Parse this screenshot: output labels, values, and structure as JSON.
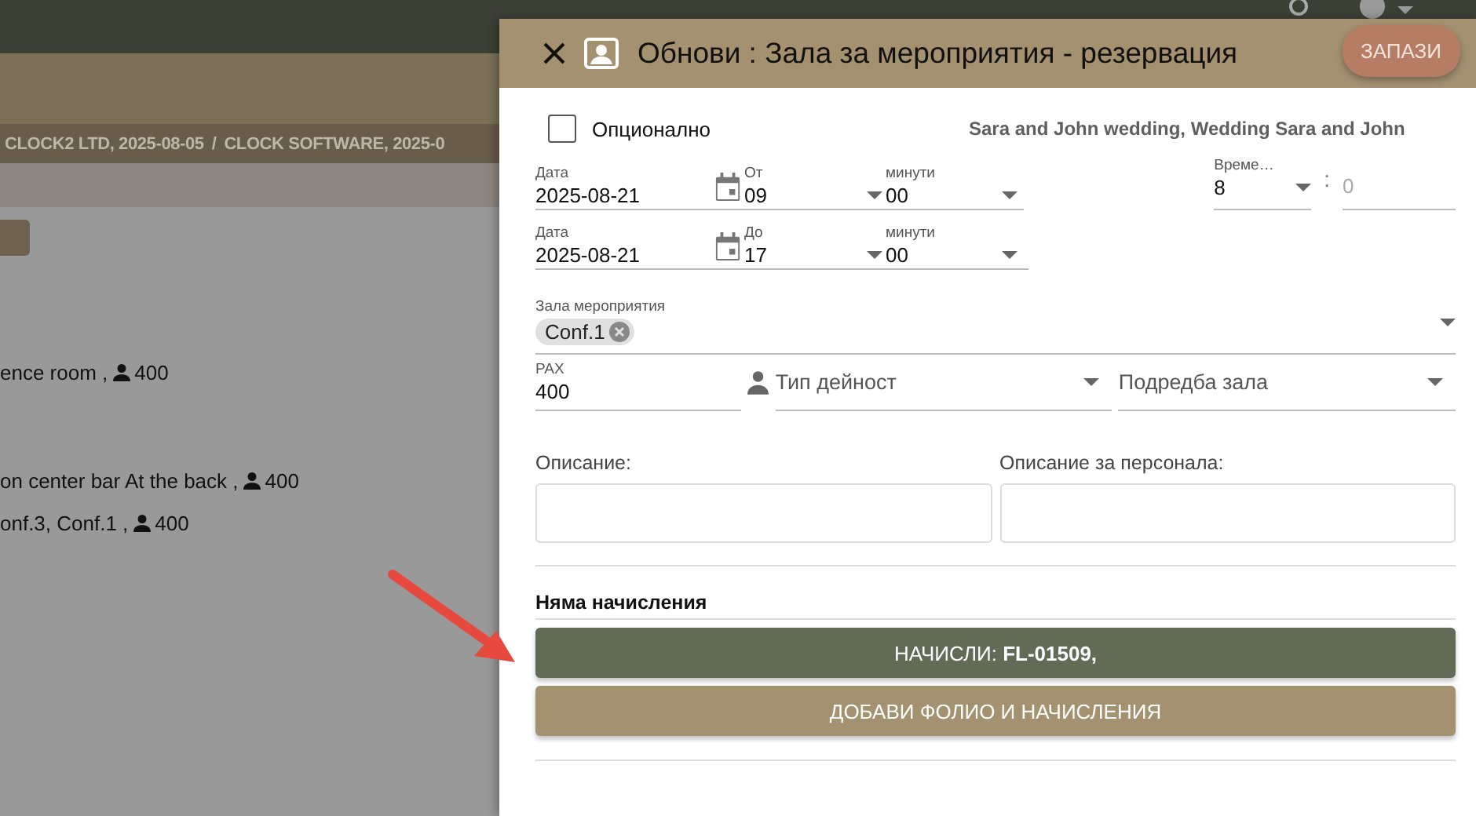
{
  "background": {
    "breadcrumbs": [
      "CLOCK2 LTD, 2025-08-05",
      "/",
      "CLOCK SOFTWARE, 2025-0"
    ],
    "list_items": [
      {
        "text": "ence room ,",
        "pax": "400"
      },
      {
        "text": "on center bar At the back ,",
        "pax": "400"
      },
      {
        "text": "onf.3, Conf.1 ,",
        "pax": "400"
      }
    ]
  },
  "dialog": {
    "title": "Обнови : Зала за мероприятия - резервация",
    "save_button": "ЗАПАЗИ",
    "optional": {
      "label": "Опционално",
      "checked": false
    },
    "event_name": "Sara and John wedding, Wedding Sara and John",
    "date_rows": [
      {
        "date_label": "Дата",
        "date": "2025-08-21",
        "hour_label": "От",
        "hour": "09",
        "minute_label": "минути",
        "minute": "00"
      },
      {
        "date_label": "Дата",
        "date": "2025-08-21",
        "hour_label": "До",
        "hour": "17",
        "minute_label": "минути",
        "minute": "00"
      }
    ],
    "duration": {
      "label": "Време…",
      "hours": "8",
      "separator": ":",
      "minutes_placeholder": "0"
    },
    "hall": {
      "label": "Зала мероприятия",
      "chips": [
        "Conf.1"
      ]
    },
    "pax": {
      "label": "PAX",
      "value": "400"
    },
    "activity_type": {
      "placeholder": "Тип дейност"
    },
    "hall_layout": {
      "placeholder": "Подредба зала"
    },
    "descriptions": [
      {
        "label": "Описание:"
      },
      {
        "label": "Описание за персонала:"
      }
    ],
    "charges_heading": "Няма начисления",
    "buttons": [
      {
        "label": "НАЧИСЛИ: **FL-01509,**",
        "kind": "primary"
      },
      {
        "label": "ДОБАВИ ФОЛИО И НАЧИСЛЕНИЯ",
        "kind": "secondary"
      }
    ]
  }
}
